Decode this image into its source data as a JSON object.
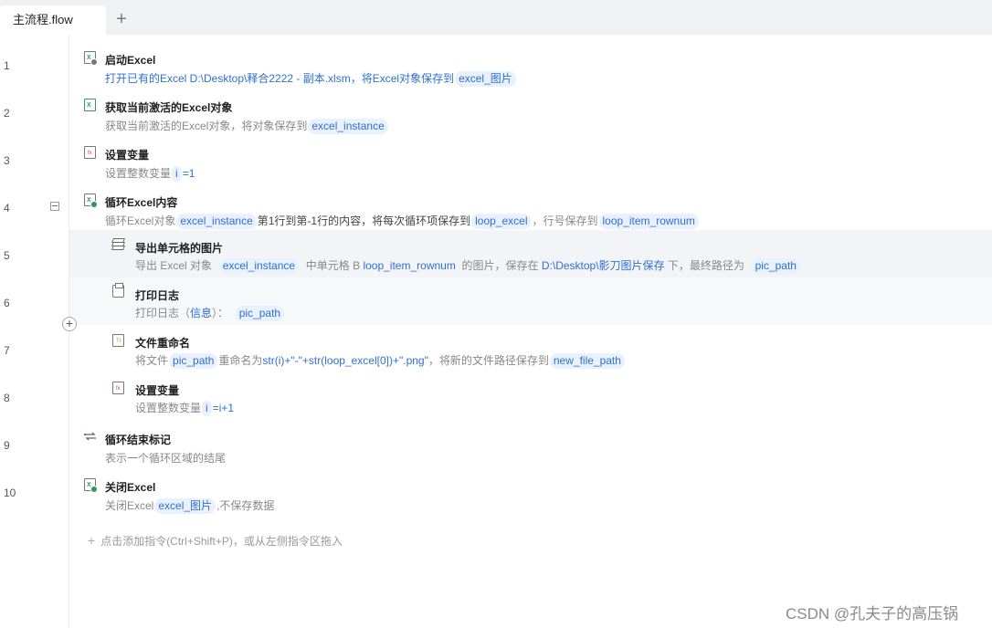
{
  "tab": {
    "label": "主流程.flow",
    "add": "+"
  },
  "line_numbers": [
    "1",
    "2",
    "3",
    "4",
    "5",
    "6",
    "7",
    "8",
    "9",
    "10"
  ],
  "steps": [
    {
      "title": "启动Excel",
      "desc": {
        "p1": "打开已有的Excel D:\\Desktop\\释合2222 - 副本.xlsm，将Excel对象保存到",
        "v1": "excel_图片"
      }
    },
    {
      "title": "获取当前激活的Excel对象",
      "desc": {
        "p1": "获取当前激活的Excel对象，将对象保存到",
        "v1": "excel_instance"
      }
    },
    {
      "title": "设置变量",
      "desc": {
        "p1": "设置整数变量",
        "v1": "i",
        "p2": "=1"
      }
    },
    {
      "title": "循环Excel内容",
      "desc": {
        "p1": "循环Excel对象",
        "v1": "excel_instance",
        "p2": "第1行到第-1行的内容，将每次循环项保存到",
        "v2": "loop_excel",
        "p3": "，行号保存到",
        "v3": "loop_item_rownum"
      }
    },
    {
      "title": "导出单元格的图片",
      "desc": {
        "p1": "导出 Excel 对象",
        "v1": "excel_instance",
        "p2": "中单元格 B",
        "v2": "loop_item_rownum",
        "p3": "的图片，保存在",
        "v3": "D:\\Desktop\\影刀图片保存",
        "p4": "下，最终路径为",
        "v4": "pic_path"
      }
    },
    {
      "title": "打印日志",
      "desc": {
        "p1": "打印日志（",
        "v1": "信息",
        "p2": "）：",
        "v2": "pic_path"
      }
    },
    {
      "title": "文件重命名",
      "desc": {
        "p1": "将文件",
        "v1": "pic_path",
        "p2": "重命名为",
        "v2": "str(i)+\"-\"+str(loop_excel[0])+\".png\"",
        "p3": "，将新的文件路径保存到",
        "v3": "new_file_path"
      }
    },
    {
      "title": "设置变量",
      "desc": {
        "p1": "设置整数变量",
        "v1": "i",
        "p2": "=i+1"
      }
    },
    {
      "title": "循环结束标记",
      "desc": {
        "p1": "表示一个循环区域的结尾"
      }
    },
    {
      "title": "关闭Excel",
      "desc": {
        "p1": "关闭Excel",
        "v1": "excel_图片",
        "p2": ",不保存数据"
      }
    }
  ],
  "collapse_symbol": "−",
  "insert_symbol": "+",
  "add_command": {
    "plus": "+",
    "text": "点击添加指令(Ctrl+Shift+P)，或从左侧指令区拖入"
  },
  "watermark": "CSDN @孔夫子的高压锅",
  "colors": {
    "accent": "#2f6fd1",
    "chip_bg": "#e8f1fd",
    "selected_row": "#f3f4f7",
    "excel_green": "#2e9b5a"
  },
  "icons": [
    "excel-open-icon",
    "excel-active-icon",
    "variable-icon",
    "excel-loop-icon",
    "layers-icon",
    "printer-icon",
    "file-rename-icon",
    "variable-icon",
    "loop-end-icon",
    "excel-close-icon"
  ]
}
